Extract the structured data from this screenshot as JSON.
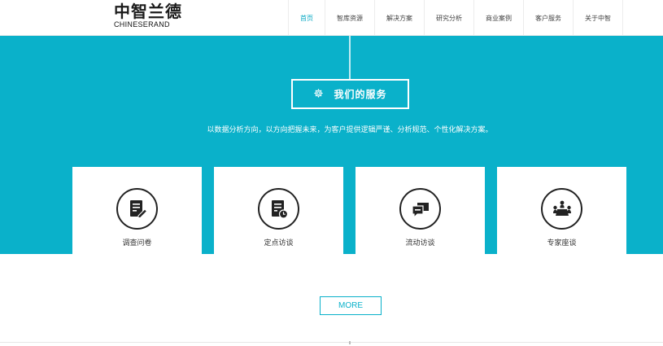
{
  "brand": {
    "name_cn": "中智兰德",
    "name_en": "CHINESERAND"
  },
  "nav": {
    "items": [
      {
        "label": "首页",
        "active": true
      },
      {
        "label": "智库资源",
        "active": false
      },
      {
        "label": "解决方案",
        "active": false
      },
      {
        "label": "研究分析",
        "active": false
      },
      {
        "label": "商业案例",
        "active": false
      },
      {
        "label": "客户服务",
        "active": false
      },
      {
        "label": "关于中智",
        "active": false
      }
    ]
  },
  "services": {
    "title": "我们的服务",
    "title_icon": "gear-icon",
    "subtitle": "以数据分析方向，以方向把握未来，为客户提供逻辑严谨、分析规范、个性化解决方案。",
    "cards": [
      {
        "label": "调查问卷",
        "icon": "questionnaire-icon"
      },
      {
        "label": "定点访谈",
        "icon": "document-clock-icon"
      },
      {
        "label": "流动访谈",
        "icon": "chat-bubbles-icon"
      },
      {
        "label": "专家座谈",
        "icon": "meeting-table-icon"
      }
    ]
  },
  "more": {
    "label": "MORE"
  },
  "colors": {
    "accent": "#0ab1ca",
    "card_bg": "#ffffff",
    "icon_dark": "#222222"
  }
}
